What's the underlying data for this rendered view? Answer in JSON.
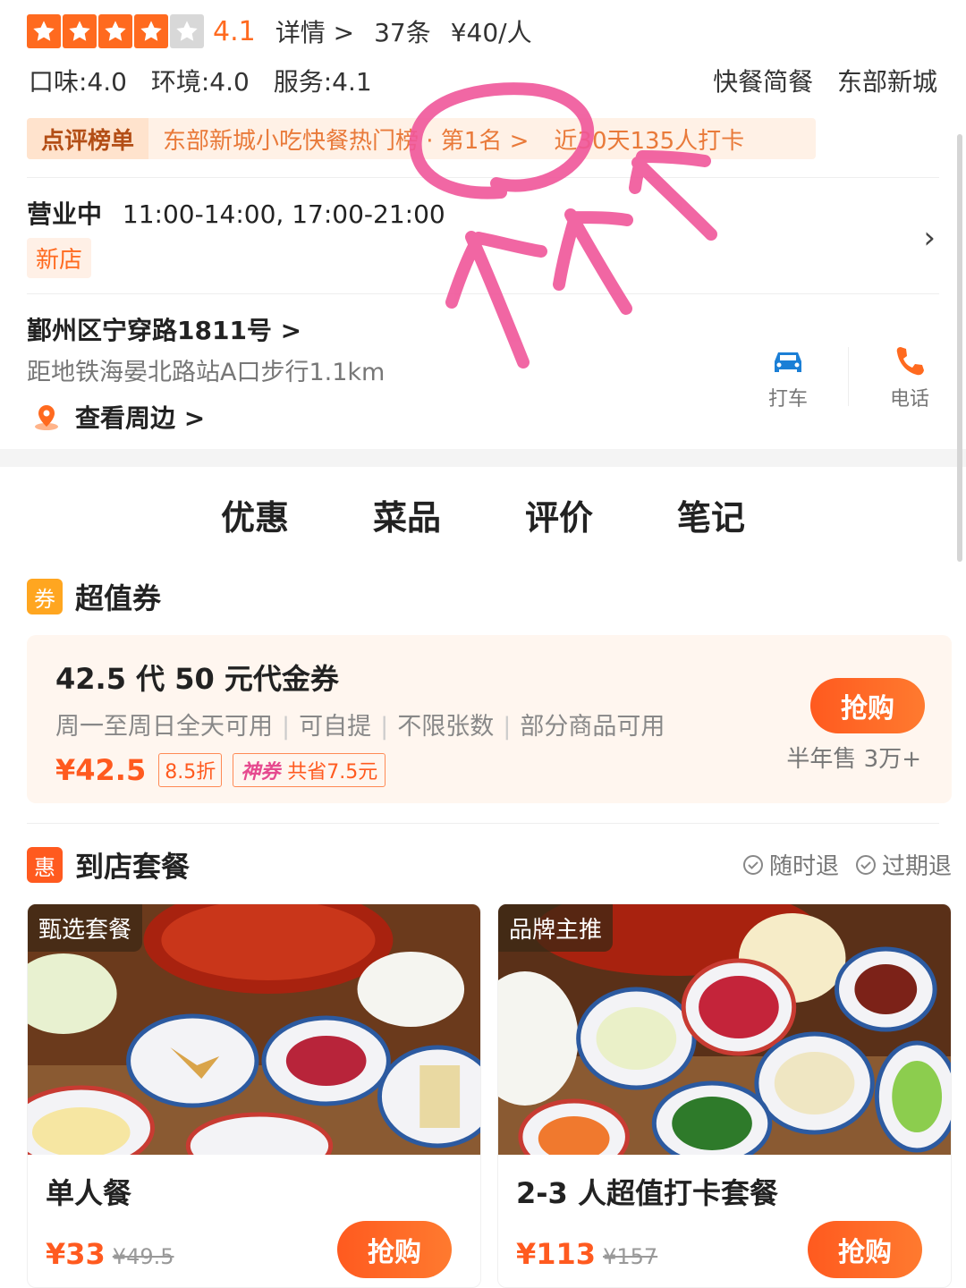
{
  "header": {
    "rating": "4.1",
    "stars_filled": 4,
    "stars_total": 5,
    "details_link": "详情 >",
    "review_count": "37条",
    "price_per_person": "¥40/人",
    "sub_scores": [
      "口味:4.0",
      "环境:4.0",
      "服务:4.1"
    ],
    "category": "快餐简餐",
    "area": "东部新城"
  },
  "rank": {
    "title": "点评榜单",
    "text": "东部新城小吃快餐热门榜 · 第1名 >",
    "checkin": "近30天135人打卡"
  },
  "hours": {
    "status": "营业中",
    "time": "11:00-14:00, 17:00-21:00",
    "tag": "新店"
  },
  "location": {
    "address": "鄞州区宁穿路1811号 >",
    "distance": "距地铁海晏北路站A口步行1.1km",
    "nearby": "查看周边 >",
    "taxi_label": "打车",
    "phone_label": "电话"
  },
  "tabs": [
    "优惠",
    "菜品",
    "评价",
    "笔记"
  ],
  "coupon_section": {
    "icon_text": "券",
    "title": "超值券",
    "coupon": {
      "title": "42.5 代 50 元代金券",
      "rules": [
        "周一至周日全天可用",
        "可自提",
        "不限张数",
        "部分商品可用"
      ],
      "price": "¥42.5",
      "discount": "8.5折",
      "god_label": "神券",
      "saving": "共省7.5元",
      "button": "抢购",
      "sold": "半年售 3万+"
    }
  },
  "package_section": {
    "icon_text": "惠",
    "title": "到店套餐",
    "refund_any": "随时退",
    "refund_expired": "过期退",
    "cards": [
      {
        "badge": "甄选套餐",
        "name": "单人餐",
        "price": "¥33",
        "original": "¥49.5",
        "button": "抢购"
      },
      {
        "badge": "品牌主推",
        "name": "2-3 人超值打卡套餐",
        "price": "¥113",
        "original": "¥157",
        "button": "抢购"
      }
    ]
  },
  "colors": {
    "accent": "#ff6a1f",
    "annotation": "#f0569a"
  }
}
